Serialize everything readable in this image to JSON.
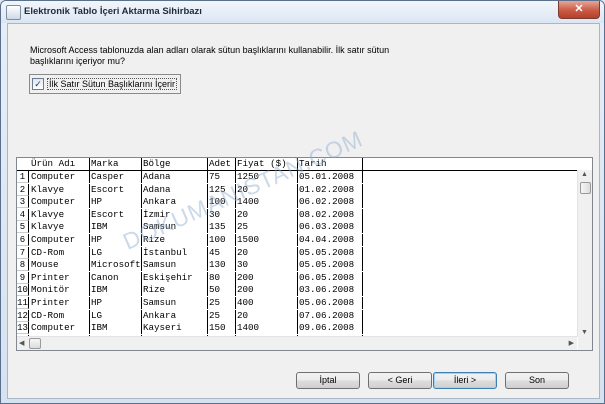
{
  "window": {
    "title": "Elektronik Tablo İçeri Aktarma Sihirbazı",
    "close_label": "✕"
  },
  "description": "Microsoft Access tablonuzda alan adları olarak sütun başlıklarını kullanabilir. İlk satır sütun başlıklarını içeriyor mu?",
  "checkbox": {
    "label": "İlk Satır Sütun Başlıklarını İçerir",
    "checked": true,
    "mark": "✓"
  },
  "grid": {
    "columns": [
      "Ürün Adı",
      "Marka",
      "Bölge",
      "Adet",
      "Fiyat ($)",
      "Tarih"
    ],
    "rows": [
      {
        "n": "1",
        "cells": [
          "Computer",
          "Casper",
          "Adana",
          "75",
          "1250",
          "05.01.2008"
        ]
      },
      {
        "n": "2",
        "cells": [
          "Klavye",
          "Escort",
          "Adana",
          "125",
          "20",
          "01.02.2008"
        ]
      },
      {
        "n": "3",
        "cells": [
          "Computer",
          "HP",
          "Ankara",
          "100",
          "1400",
          "06.02.2008"
        ]
      },
      {
        "n": "4",
        "cells": [
          "Klavye",
          "Escort",
          "İzmir",
          "30",
          "20",
          "08.02.2008"
        ]
      },
      {
        "n": "5",
        "cells": [
          "Klavye",
          "IBM",
          "Samsun",
          "135",
          "25",
          "06.03.2008"
        ]
      },
      {
        "n": "6",
        "cells": [
          "Computer",
          "HP",
          "Rize",
          "100",
          "1500",
          "04.04.2008"
        ]
      },
      {
        "n": "7",
        "cells": [
          "CD-Rom",
          "LG",
          "İstanbul",
          "45",
          "20",
          "05.05.2008"
        ]
      },
      {
        "n": "8",
        "cells": [
          "Mouse",
          "Microsoft",
          "Samsun",
          "130",
          "30",
          "05.05.2008"
        ]
      },
      {
        "n": "9",
        "cells": [
          "Printer",
          "Canon",
          "Eskişehir",
          "80",
          "200",
          "06.05.2008"
        ]
      },
      {
        "n": "10",
        "cells": [
          "Monitör",
          "IBM",
          "Rize",
          "50",
          "200",
          "03.06.2008"
        ]
      },
      {
        "n": "11",
        "cells": [
          "Printer",
          "HP",
          "Samsun",
          "25",
          "400",
          "05.06.2008"
        ]
      },
      {
        "n": "12",
        "cells": [
          "CD-Rom",
          "LG",
          "Ankara",
          "25",
          "20",
          "07.06.2008"
        ]
      },
      {
        "n": "13",
        "cells": [
          "Computer",
          "IBM",
          "Kayseri",
          "150",
          "1400",
          "09.06.2008"
        ]
      },
      {
        "n": "14",
        "cells": [
          "CD-Rom",
          "LG",
          "Aksaray",
          "50",
          "20",
          "25.06.2008"
        ]
      }
    ]
  },
  "buttons": {
    "cancel": "İptal",
    "back": "< Geri",
    "next": "İleri >",
    "finish": "Son"
  },
  "watermark": "DOKUMANISTAN.COM",
  "icons": {
    "up_arrow": "▲",
    "down_arrow": "▼",
    "left_arrow": "◀",
    "right_arrow": "▶"
  }
}
